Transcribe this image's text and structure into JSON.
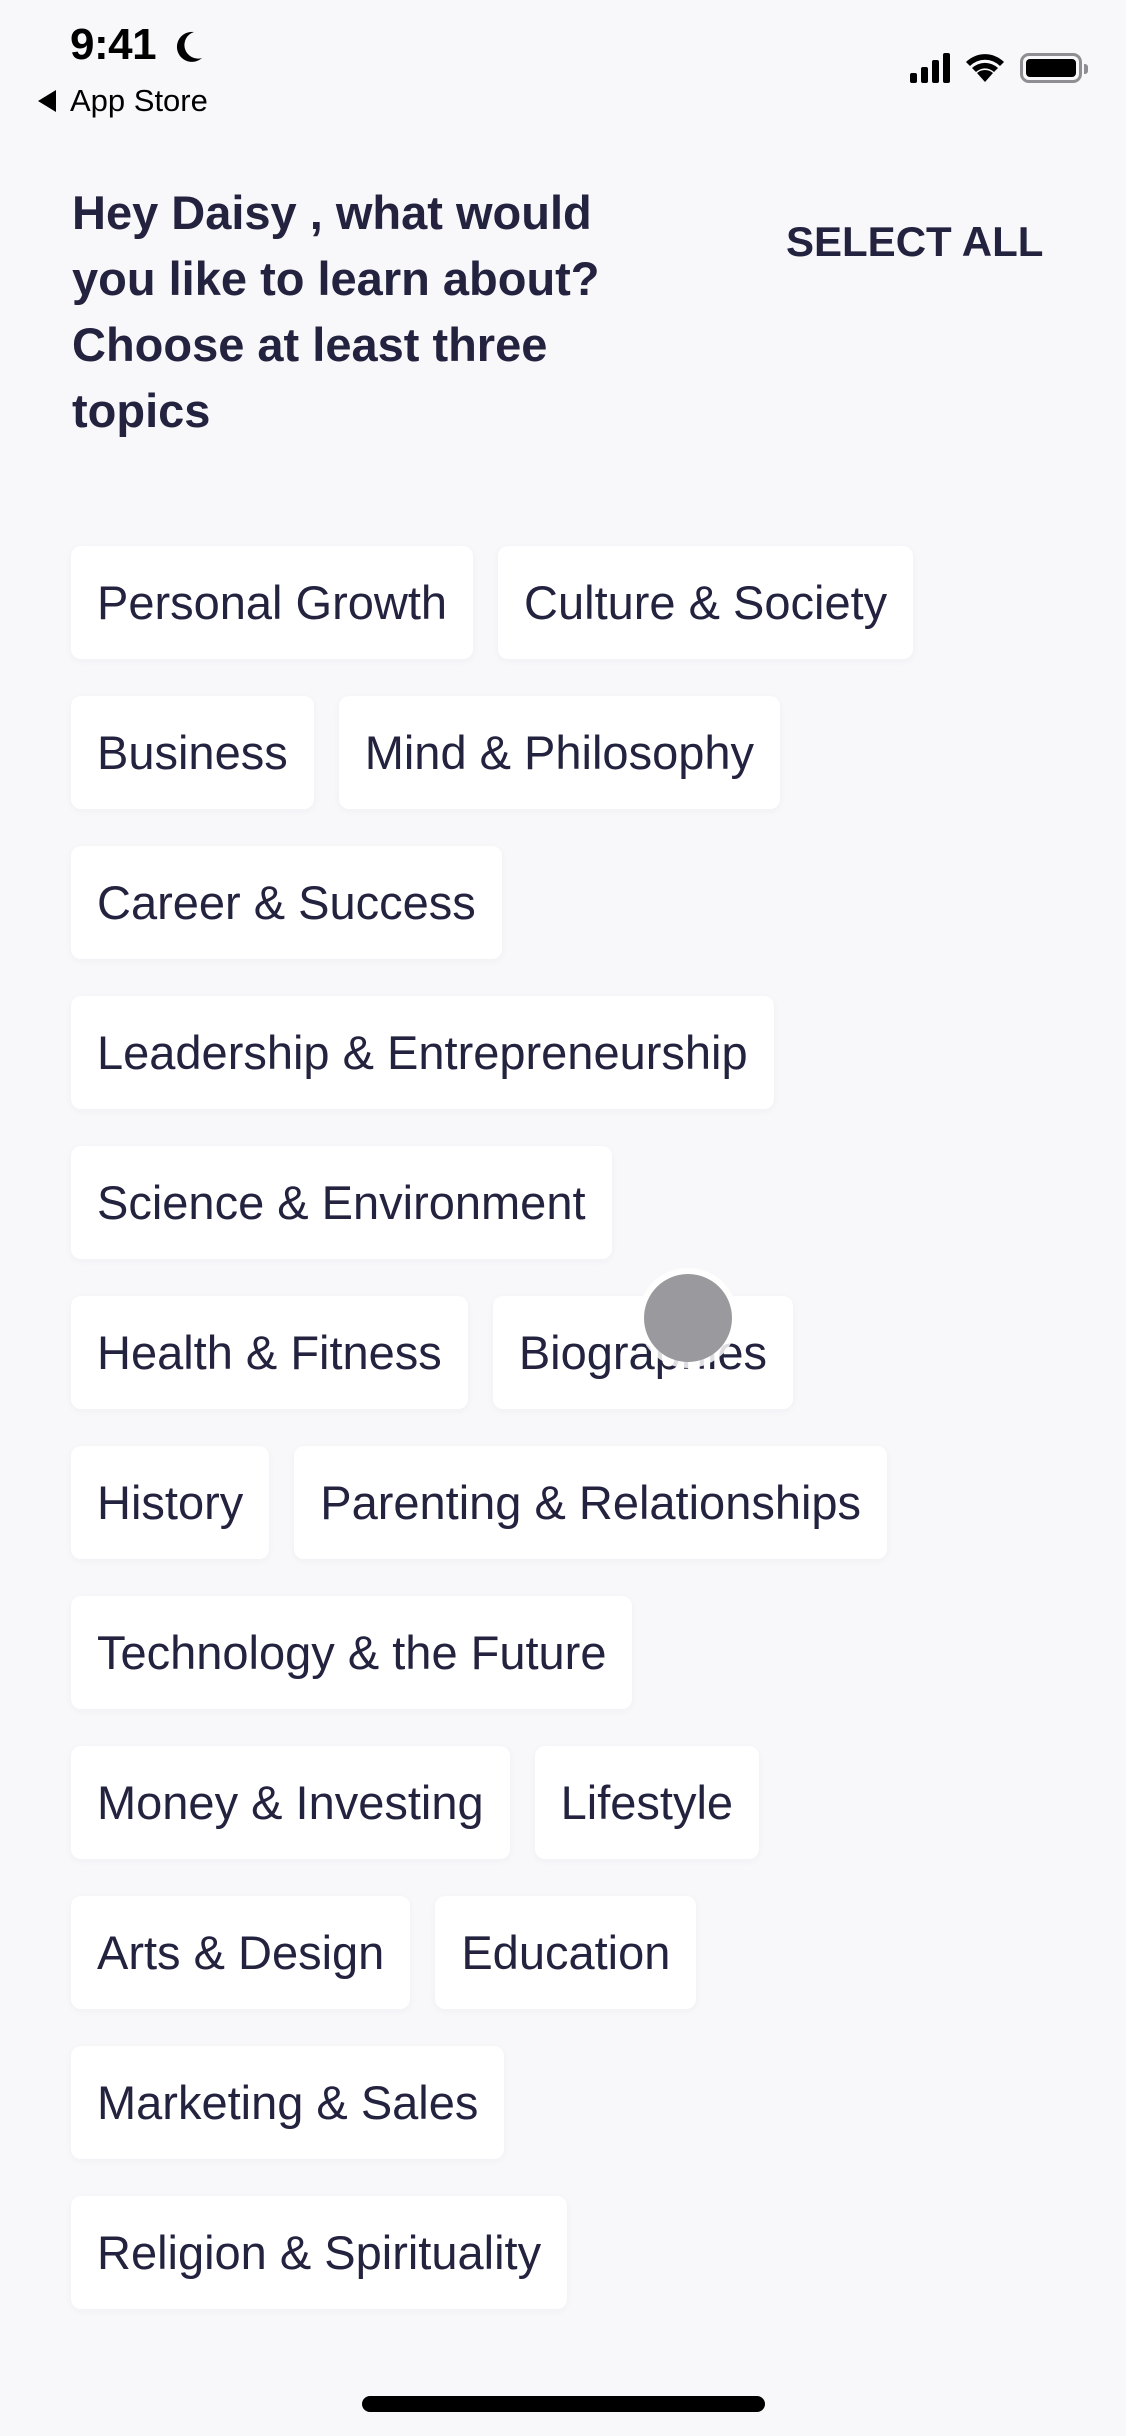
{
  "status_bar": {
    "time": "9:41",
    "focus_icon": "moon-icon",
    "back_app_label": "App Store",
    "icons": [
      "cellular-signal-icon",
      "wifi-icon",
      "battery-icon"
    ]
  },
  "header": {
    "title": "Hey Daisy , what would you like to learn about? Choose at least three topics",
    "select_all_label": "SELECT ALL"
  },
  "topic_rows": [
    [
      "Personal Growth",
      "Culture & Society"
    ],
    [
      "Business",
      "Mind & Philosophy"
    ],
    [
      "Career & Success"
    ],
    [
      "Leadership & Entrepreneurship"
    ],
    [
      "Science & Environment"
    ],
    [
      "Health & Fitness",
      "Biographies"
    ],
    [
      "History",
      "Parenting & Relationships"
    ],
    [
      "Technology & the Future"
    ],
    [
      "Money & Investing",
      "Lifestyle"
    ],
    [
      "Arts & Design",
      "Education"
    ],
    [
      "Marketing & Sales"
    ],
    [
      "Religion & Spirituality"
    ]
  ],
  "colors": {
    "background": "#f8f7fa",
    "chip_background": "#ffffff",
    "text": "#23233f",
    "touch_indicator": "#9a999e"
  }
}
